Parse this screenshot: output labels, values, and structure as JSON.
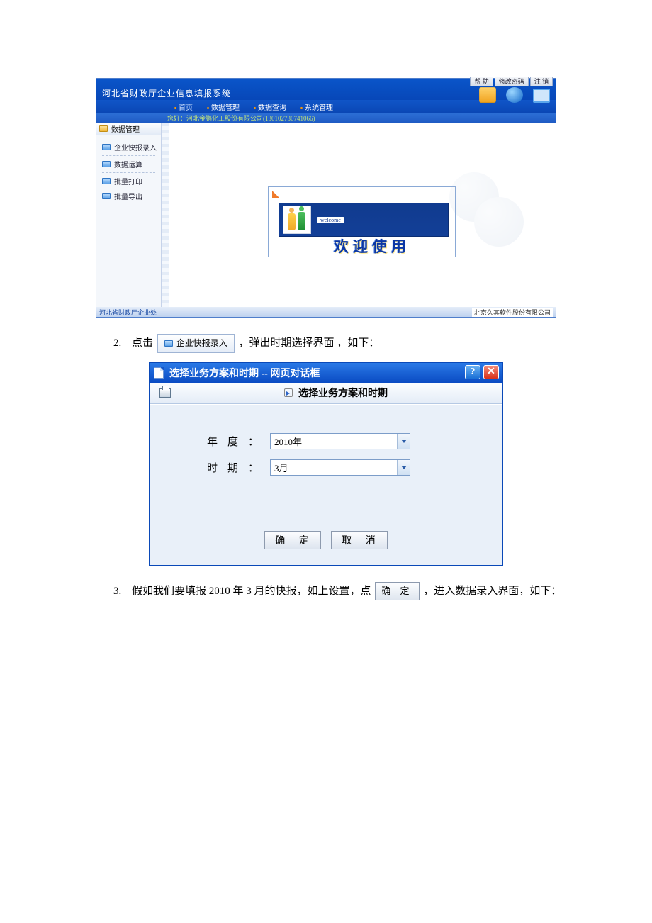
{
  "app": {
    "title": "河北省财政厅企业信息填报系统",
    "top_buttons": {
      "help": "帮 助",
      "changepw": "修改密码",
      "logout": "注 销"
    },
    "menu": {
      "home": "首页",
      "data_manage": "数据管理",
      "data_query": "数据查询",
      "sys_manage": "系统管理"
    },
    "greeting": "您好：河北金鹏化工股份有限公司(130102730741066)",
    "sidebar": {
      "header": "数据管理",
      "items": [
        "企业快报录入",
        "数据运算",
        "批量打印",
        "批量导出"
      ]
    },
    "welcome_pill": "welcome",
    "welcome_text": "欢迎使用",
    "footer_left": "河北省财政厅企业处",
    "footer_right": "北京久其软件股份有限公司"
  },
  "step2": {
    "prefix": "点击",
    "button_label": "企业快报录入",
    "suffix": "，弹出时期选择界面 ，如下："
  },
  "dialog": {
    "title": "选择业务方案和时期 -- 网页对话框",
    "subtitle": "选择业务方案和时期",
    "year_label": "年度",
    "period_label": "时期",
    "year_value": "2010年",
    "period_value": "3月",
    "ok": "确 定",
    "cancel": "取 消"
  },
  "step3": {
    "part1": "假如我们要填报 2010 年 3 月的快报，如上设置，点",
    "confirm": "确 定",
    "part2": "，进入数据录入界面，如下："
  }
}
